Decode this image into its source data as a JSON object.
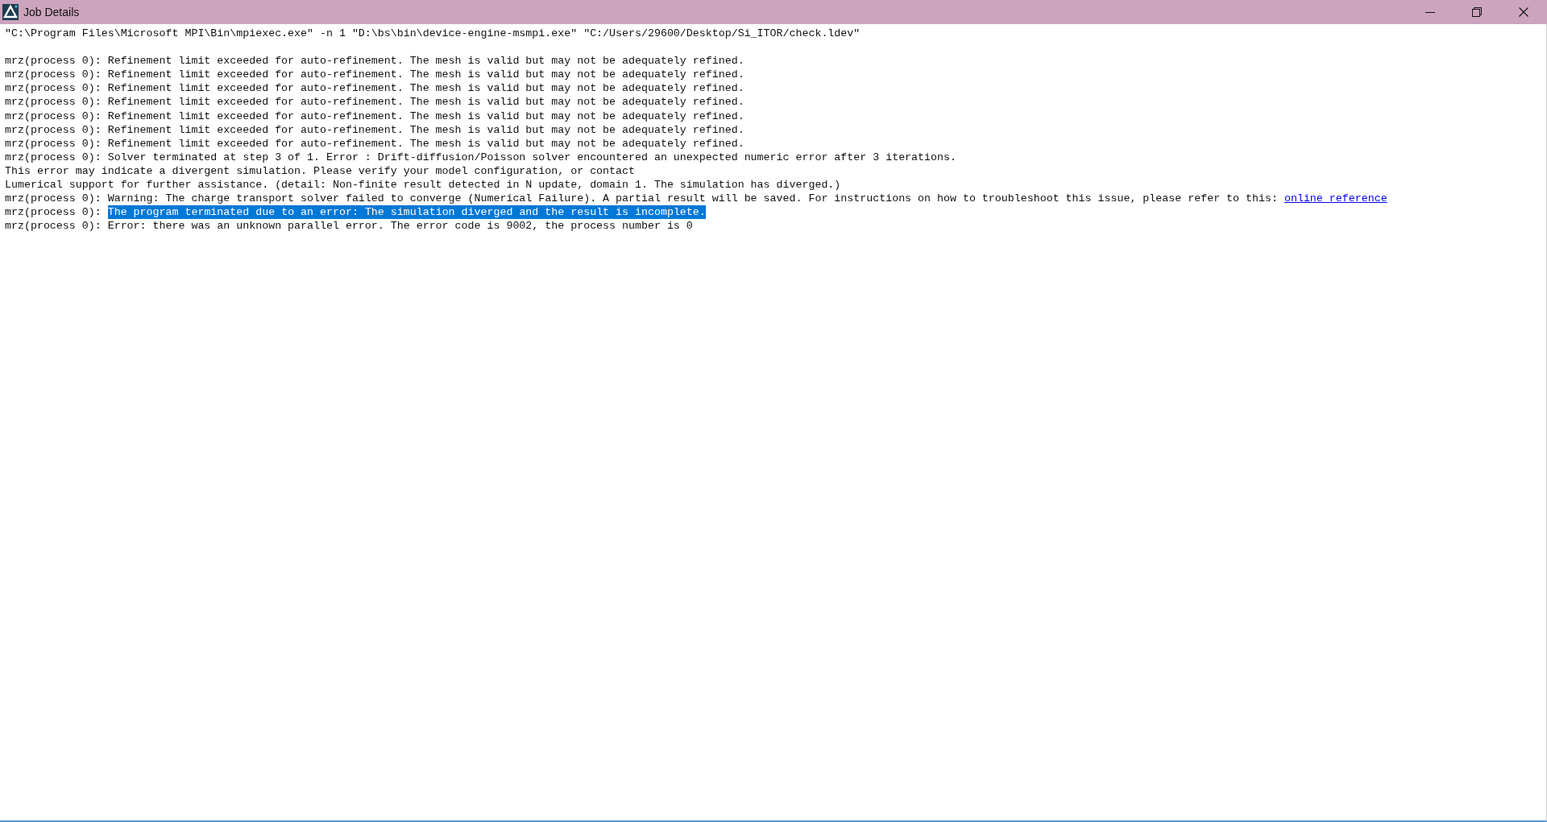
{
  "window": {
    "title": "Job Details"
  },
  "command": "″C:\\Program Files\\Microsoft MPI\\Bin\\mpiexec.exe″ -n 1 ″D:\\bs\\bin\\device-engine-msmpi.exe″ ″C:/Users/29600/Desktop/Si_ITOR/check.ldev″",
  "log": [
    {
      "text": "mrz(process 0): Refinement limit exceeded for auto-refinement. The mesh is valid but may not be adequately refined."
    },
    {
      "text": "mrz(process 0): Refinement limit exceeded for auto-refinement. The mesh is valid but may not be adequately refined."
    },
    {
      "text": "mrz(process 0): Refinement limit exceeded for auto-refinement. The mesh is valid but may not be adequately refined."
    },
    {
      "text": "mrz(process 0): Refinement limit exceeded for auto-refinement. The mesh is valid but may not be adequately refined."
    },
    {
      "text": "mrz(process 0): Refinement limit exceeded for auto-refinement. The mesh is valid but may not be adequately refined."
    },
    {
      "text": "mrz(process 0): Refinement limit exceeded for auto-refinement. The mesh is valid but may not be adequately refined."
    },
    {
      "text": "mrz(process 0): Refinement limit exceeded for auto-refinement. The mesh is valid but may not be adequately refined."
    },
    {
      "text": "mrz(process 0): Solver terminated at step 3 of 1. Error : Drift-diffusion/Poisson solver encountered an unexpected numeric error after 3 iterations."
    },
    {
      "text": "This error may indicate a divergent simulation. Please verify your model configuration, or contact"
    },
    {
      "text": "Lumerical support for further assistance. (detail: Non-finite result detected in N update, domain 1. The simulation has diverged.)"
    },
    {
      "text": "mrz(process 0): Warning: The charge transport solver failed to converge (Numerical Failure). A partial result will be saved. For instructions on how to troubleshoot this issue, please refer to this:",
      "link": "online reference"
    },
    {
      "text": "mrz(process 0):",
      "selection": "The program terminated due to an error: The simulation diverged and the result is incomplete."
    },
    {
      "text": "mrz(process 0): Error: there was an unknown parallel error. The error code is 9002, the process number is 0"
    }
  ]
}
